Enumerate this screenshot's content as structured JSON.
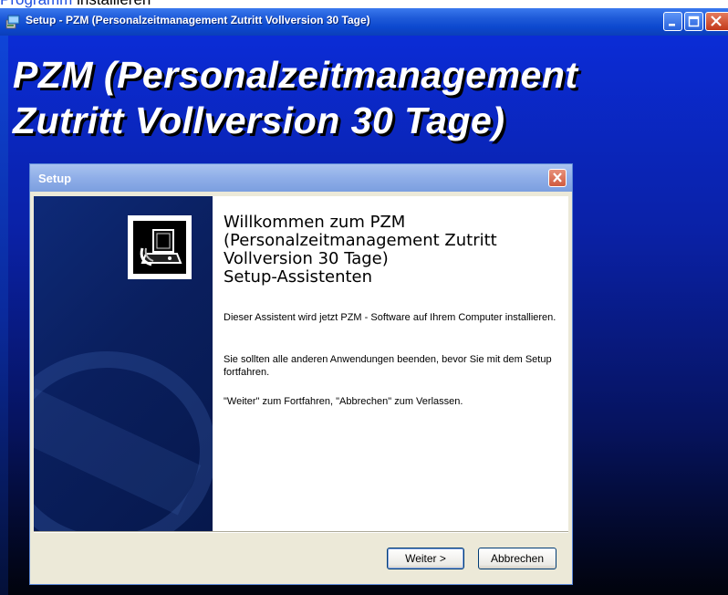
{
  "page_caption": {
    "link": "Programm",
    "rest": " installieren"
  },
  "outer_window": {
    "title": "Setup - PZM (Personalzeitmanagement Zutritt Vollversion 30 Tage)",
    "big_title_line1": "PZM (Personalzeitmanagement",
    "big_title_line2": "Zutritt Vollversion 30 Tage)"
  },
  "dialog": {
    "title": "Setup",
    "welcome_line1": "Willkommen zum PZM",
    "welcome_line2": "(Personalzeitmanagement Zutritt",
    "welcome_line3": "Vollversion 30 Tage)",
    "welcome_line4": "Setup-Assistenten",
    "para1": "Dieser Assistent wird jetzt PZM - Software auf Ihrem Computer installieren.",
    "para2": "Sie sollten alle anderen Anwendungen beenden, bevor Sie mit dem Setup fortfahren.",
    "para3": "\"Weiter\" zum Fortfahren, \"Abbrechen\" zum Verlassen.",
    "next_label": "Weiter >",
    "cancel_label": "Abbrechen"
  },
  "icons": [
    "setup-app-icon",
    "minimize-icon",
    "maximize-icon",
    "close-icon",
    "dialog-close-icon",
    "installer-computer-icon"
  ],
  "colors": {
    "desktop_blue": "#0b2cd6",
    "titlebar_blue": "#0c48cf",
    "dialog_bg": "#ece9d8",
    "accent_close": "#c2391b"
  }
}
